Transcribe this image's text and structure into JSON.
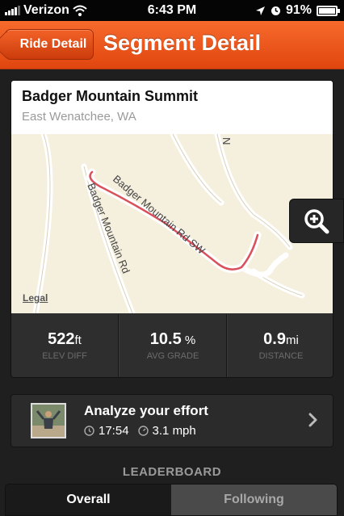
{
  "status_bar": {
    "carrier": "Verizon",
    "time": "6:43 PM",
    "battery": "91%",
    "battery_level": 0.91
  },
  "nav": {
    "back_label": "Ride Detail",
    "title": "Segment Detail"
  },
  "segment": {
    "name": "Badger Mountain Summit",
    "location": "East Wenatchee, WA",
    "map": {
      "road_label_1": "Badger Mountain Rd",
      "road_label_2": "Badger Mountain Rd SW",
      "road_label_3": "N",
      "legal": "Legal"
    },
    "stats": [
      {
        "value": "522",
        "unit": "ft",
        "label": "ELEV DIFF"
      },
      {
        "value": "10.5",
        "unit": " %",
        "label": "AVG GRADE"
      },
      {
        "value": "0.9",
        "unit": "mi",
        "label": "DISTANCE"
      }
    ]
  },
  "effort": {
    "title": "Analyze your effort",
    "time": "17:54",
    "speed": "3.1 mph"
  },
  "leaderboard": {
    "label": "LEADERBOARD",
    "tabs": [
      "Overall",
      "Following"
    ]
  },
  "colors": {
    "accent": "#e8521a",
    "route": "#d9505b"
  }
}
